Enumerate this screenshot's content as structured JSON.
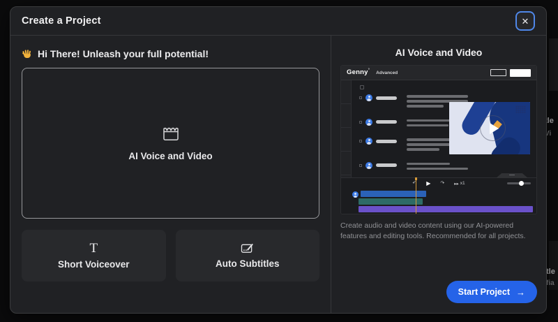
{
  "modal": {
    "title": "Create a Project",
    "close_glyph": "✕"
  },
  "left": {
    "greeting": "Hi There! Unleash your full potential!",
    "main_option": {
      "label": "AI Voice and Video"
    },
    "options": [
      {
        "icon": "T",
        "label": "Short Voiceover"
      },
      {
        "label": "Auto Subtitles"
      }
    ]
  },
  "right": {
    "heading": "AI Voice and Video",
    "preview": {
      "logo": "Genny",
      "logo_mark": "°",
      "mode": "Advanced",
      "speed": "x1"
    },
    "description": "Create audio and video content using our AI-powered features and editing tools. Recommended for all projects.",
    "start_button": "Start Project",
    "arrow": "→"
  },
  "background_fragments": {
    "a": "tle",
    "b": "Vi",
    "c": "tle",
    "d": "fia"
  },
  "colors": {
    "accent": "#2563e8",
    "focus_ring": "#4f87e8",
    "timeline_blue": "#2b62b8",
    "timeline_teal": "#2d6b66",
    "timeline_purple": "#6a51c9",
    "playhead_orange": "#d79b3a"
  }
}
